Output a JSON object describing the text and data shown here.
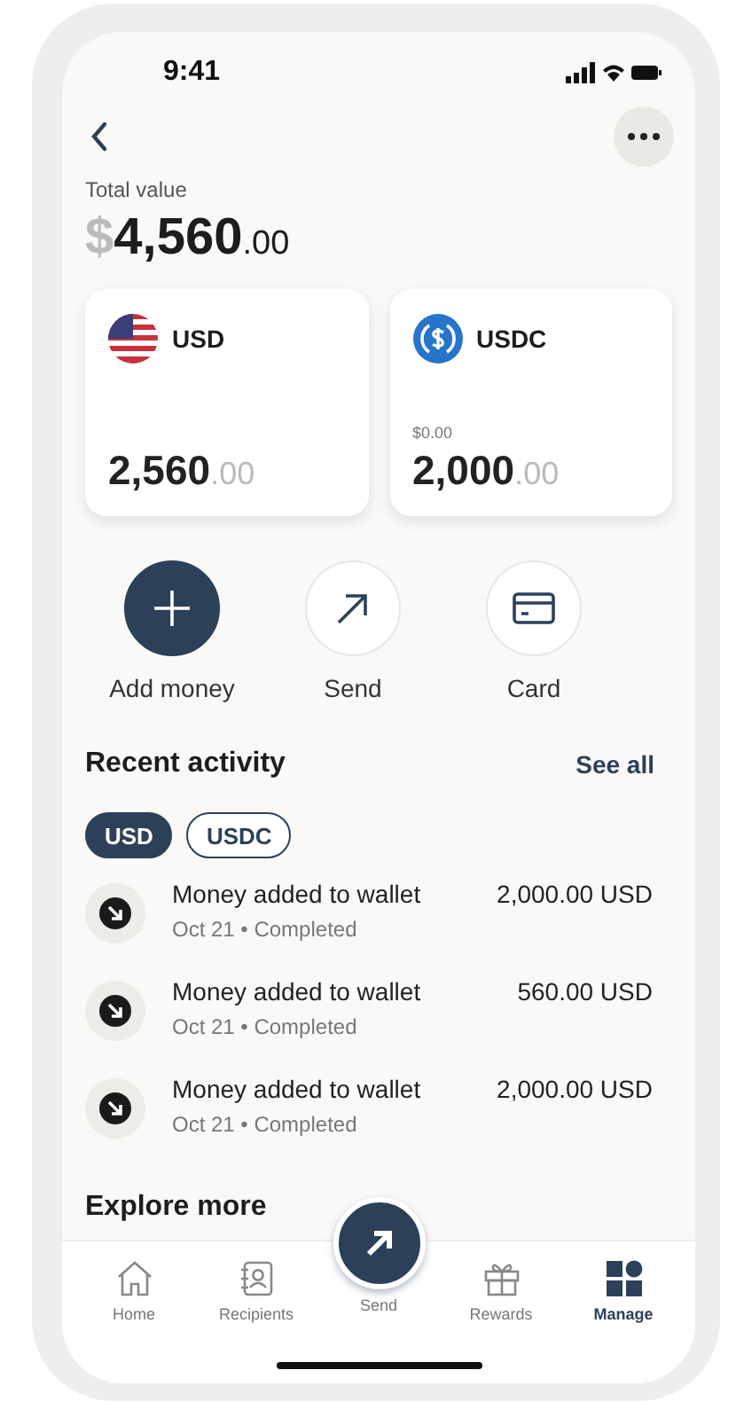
{
  "status_bar": {
    "time": "9:41"
  },
  "total": {
    "label": "Total value",
    "currency": "$",
    "whole": "4,560",
    "cents": ".00"
  },
  "accounts": [
    {
      "kind": "usd",
      "name": "USD",
      "whole": "2,560",
      "cents": ".00"
    },
    {
      "kind": "usdc",
      "name": "USDC",
      "sub_value": "$0.00",
      "whole": "2,000",
      "cents": ".00"
    }
  ],
  "actions": [
    {
      "kind": "add",
      "label": "Add money",
      "primary": true
    },
    {
      "kind": "send",
      "label": "Send",
      "primary": false
    },
    {
      "kind": "card",
      "label": "Card",
      "primary": false
    }
  ],
  "recent": {
    "title": "Recent activity",
    "see_all": "See all",
    "filters": [
      {
        "label": "USD",
        "selected": true
      },
      {
        "label": "USDC",
        "selected": false
      }
    ],
    "items": [
      {
        "title": "Money added to wallet",
        "meta": "Oct 21 • Completed",
        "amount": "2,000.00 USD"
      },
      {
        "title": "Money added to wallet",
        "meta": "Oct 21 • Completed",
        "amount": "560.00 USD"
      },
      {
        "title": "Money added to wallet",
        "meta": "Oct 21 • Completed",
        "amount": "2,000.00 USD"
      }
    ]
  },
  "explore": {
    "title": "Explore more"
  },
  "nav": [
    {
      "kind": "home",
      "label": "Home",
      "selected": false
    },
    {
      "kind": "recipients",
      "label": "Recipients",
      "selected": false
    },
    {
      "kind": "send",
      "label": "Send",
      "selected": false
    },
    {
      "kind": "rewards",
      "label": "Rewards",
      "selected": false
    },
    {
      "kind": "manage",
      "label": "Manage",
      "selected": true
    }
  ]
}
